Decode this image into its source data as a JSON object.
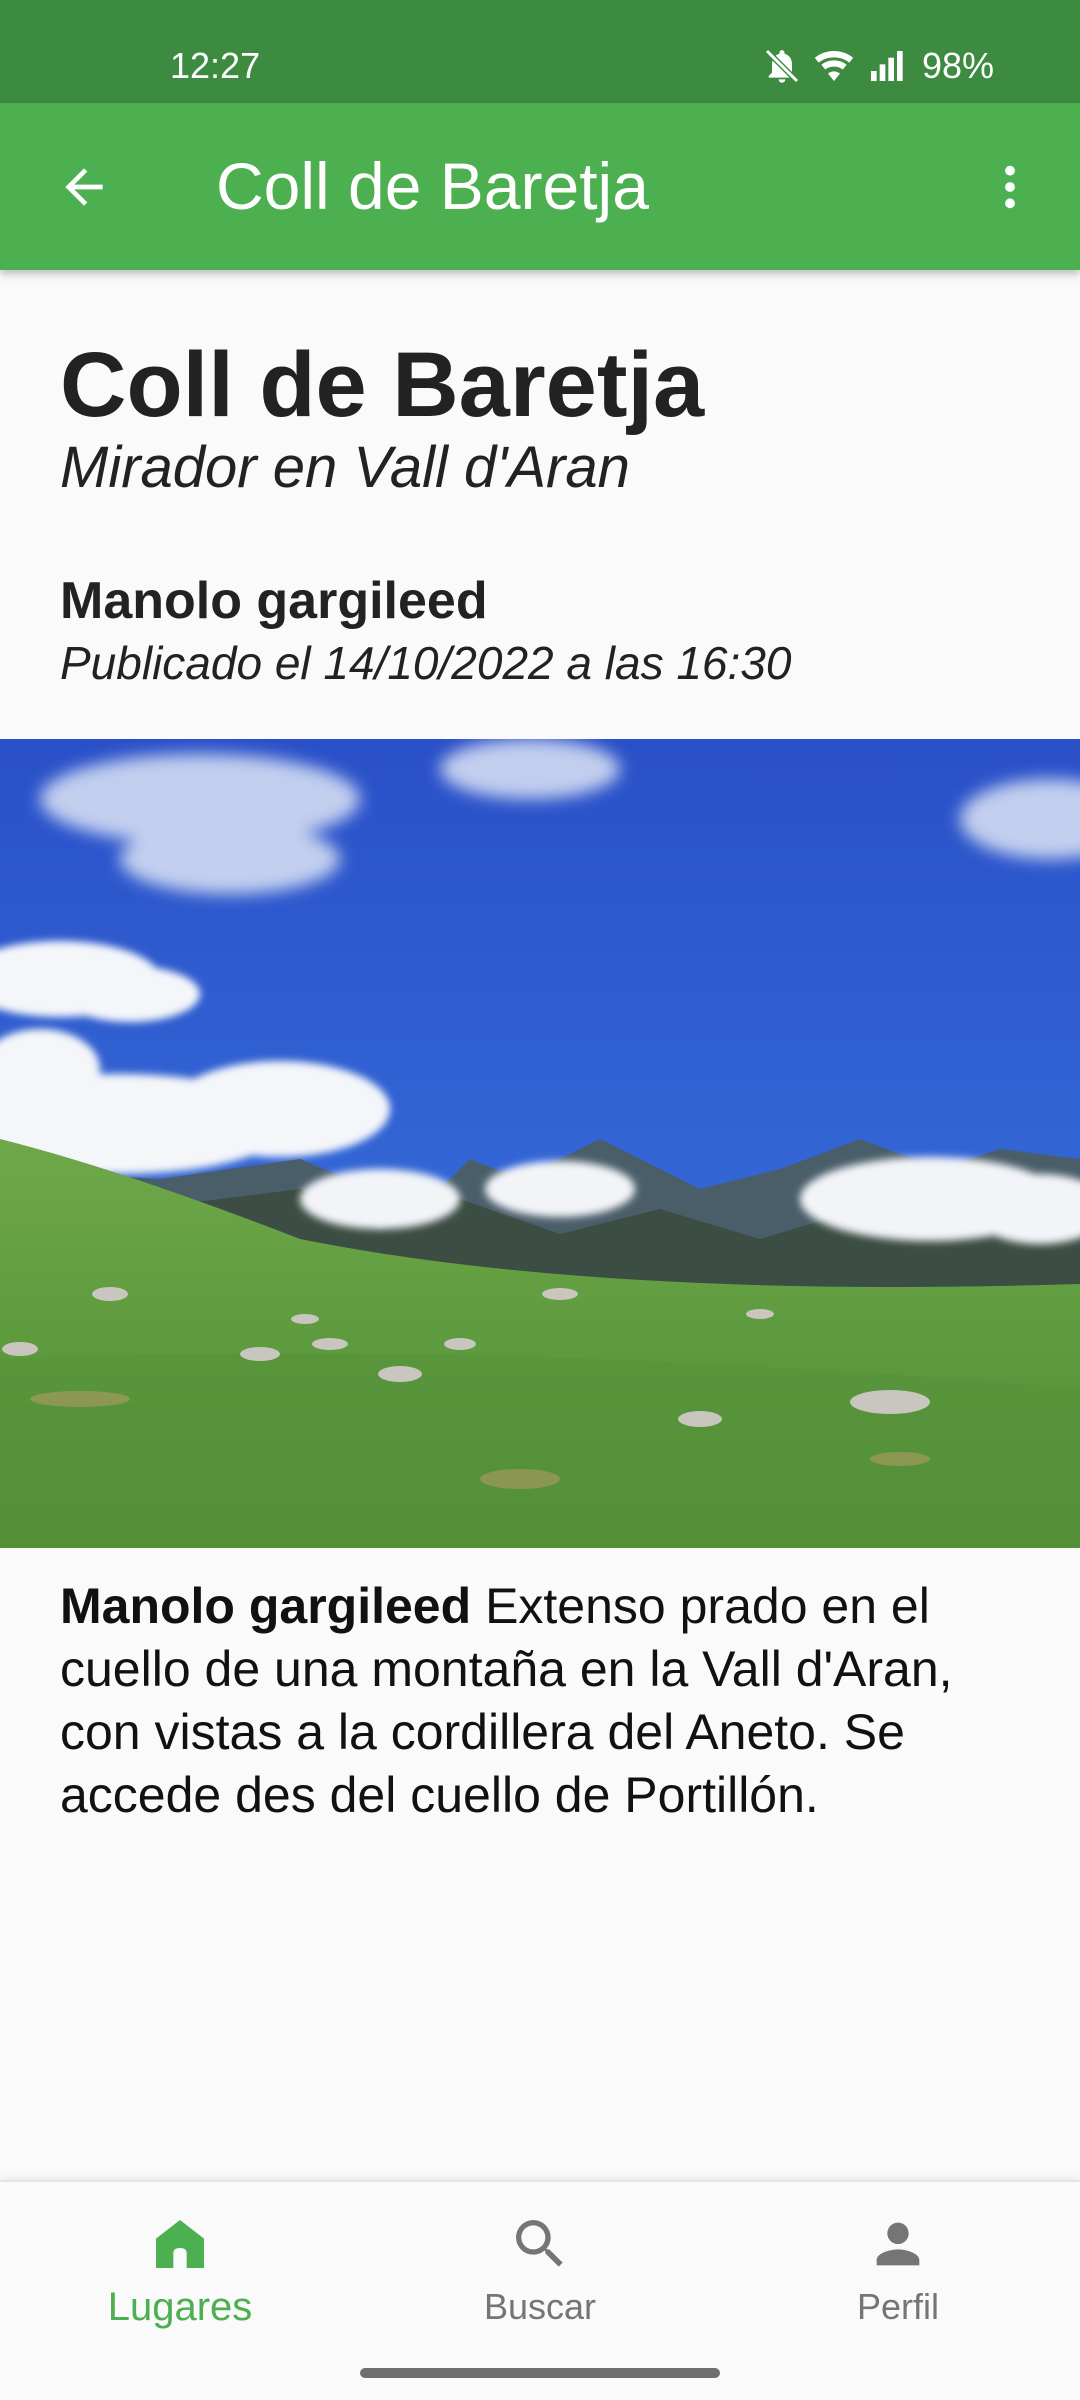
{
  "status_bar": {
    "time": "12:27",
    "battery": "98%",
    "icons": [
      "bell-off-icon",
      "wifi-icon",
      "signal-icon"
    ]
  },
  "app_bar": {
    "title": "Coll de Baretja",
    "back_icon": "arrow-back-icon",
    "menu_icon": "more-vert-icon",
    "color": "#4caf50",
    "status_color": "#3d8b40"
  },
  "place": {
    "title": "Coll de Baretja",
    "subtitle": "Mirador en Vall d'Aran",
    "author": "Manolo gargileed",
    "published": "Publicado el 14/10/2022 a las 16:30"
  },
  "description": {
    "author": "Manolo gargileed",
    "text": " Extenso prado en el cuello de una montaña en la Vall d'Aran, con vistas a la cordillera del Aneto. Se accede des del cuello de Portillón."
  },
  "bottom_nav": {
    "items": [
      {
        "label": "Lugares",
        "icon": "home-icon",
        "active": true
      },
      {
        "label": "Buscar",
        "icon": "search-icon",
        "active": false
      },
      {
        "label": "Perfil",
        "icon": "person-icon",
        "active": false
      }
    ],
    "active_color": "#4caf50",
    "inactive_color": "#757575"
  }
}
